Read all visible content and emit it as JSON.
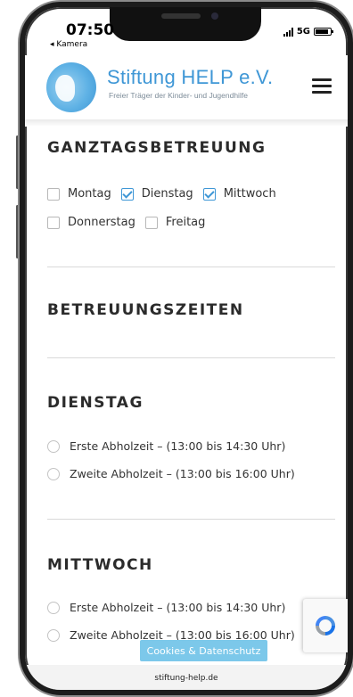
{
  "status_bar": {
    "time": "07:50",
    "back_label": "◂ Kamera",
    "network": "5G"
  },
  "header": {
    "logo_title": "Stiftung HELP e.V.",
    "logo_subtitle": "Freier Träger der Kinder- und Jugendhilfe"
  },
  "ganztag": {
    "title": "GANZTAGSBETREUUNG",
    "days": [
      {
        "label": "Montag",
        "checked": false
      },
      {
        "label": "Dienstag",
        "checked": true
      },
      {
        "label": "Mittwoch",
        "checked": true
      },
      {
        "label": "Donnerstag",
        "checked": false
      },
      {
        "label": "Freitag",
        "checked": false
      }
    ]
  },
  "betreuungszeiten": {
    "title": "BETREUUNGSZEITEN"
  },
  "dienstag": {
    "title": "DIENSTAG",
    "options": [
      "Erste Abholzeit – (13:00 bis 14:30 Uhr)",
      "Zweite Abholzeit – (13:00 bis 16:00 Uhr)"
    ]
  },
  "mittwoch": {
    "title": "MITTWOCH",
    "options": [
      "Erste Abholzeit – (13:00 bis 14:30 Uhr)",
      "Zweite Abholzeit – (13:00 bis 16:00 Uhr)"
    ]
  },
  "cookie_button": "Cookies & Datenschutz",
  "url": "stiftung-help.de",
  "colors": {
    "accent": "#3f97d6",
    "cookie": "#7cc8ea"
  }
}
